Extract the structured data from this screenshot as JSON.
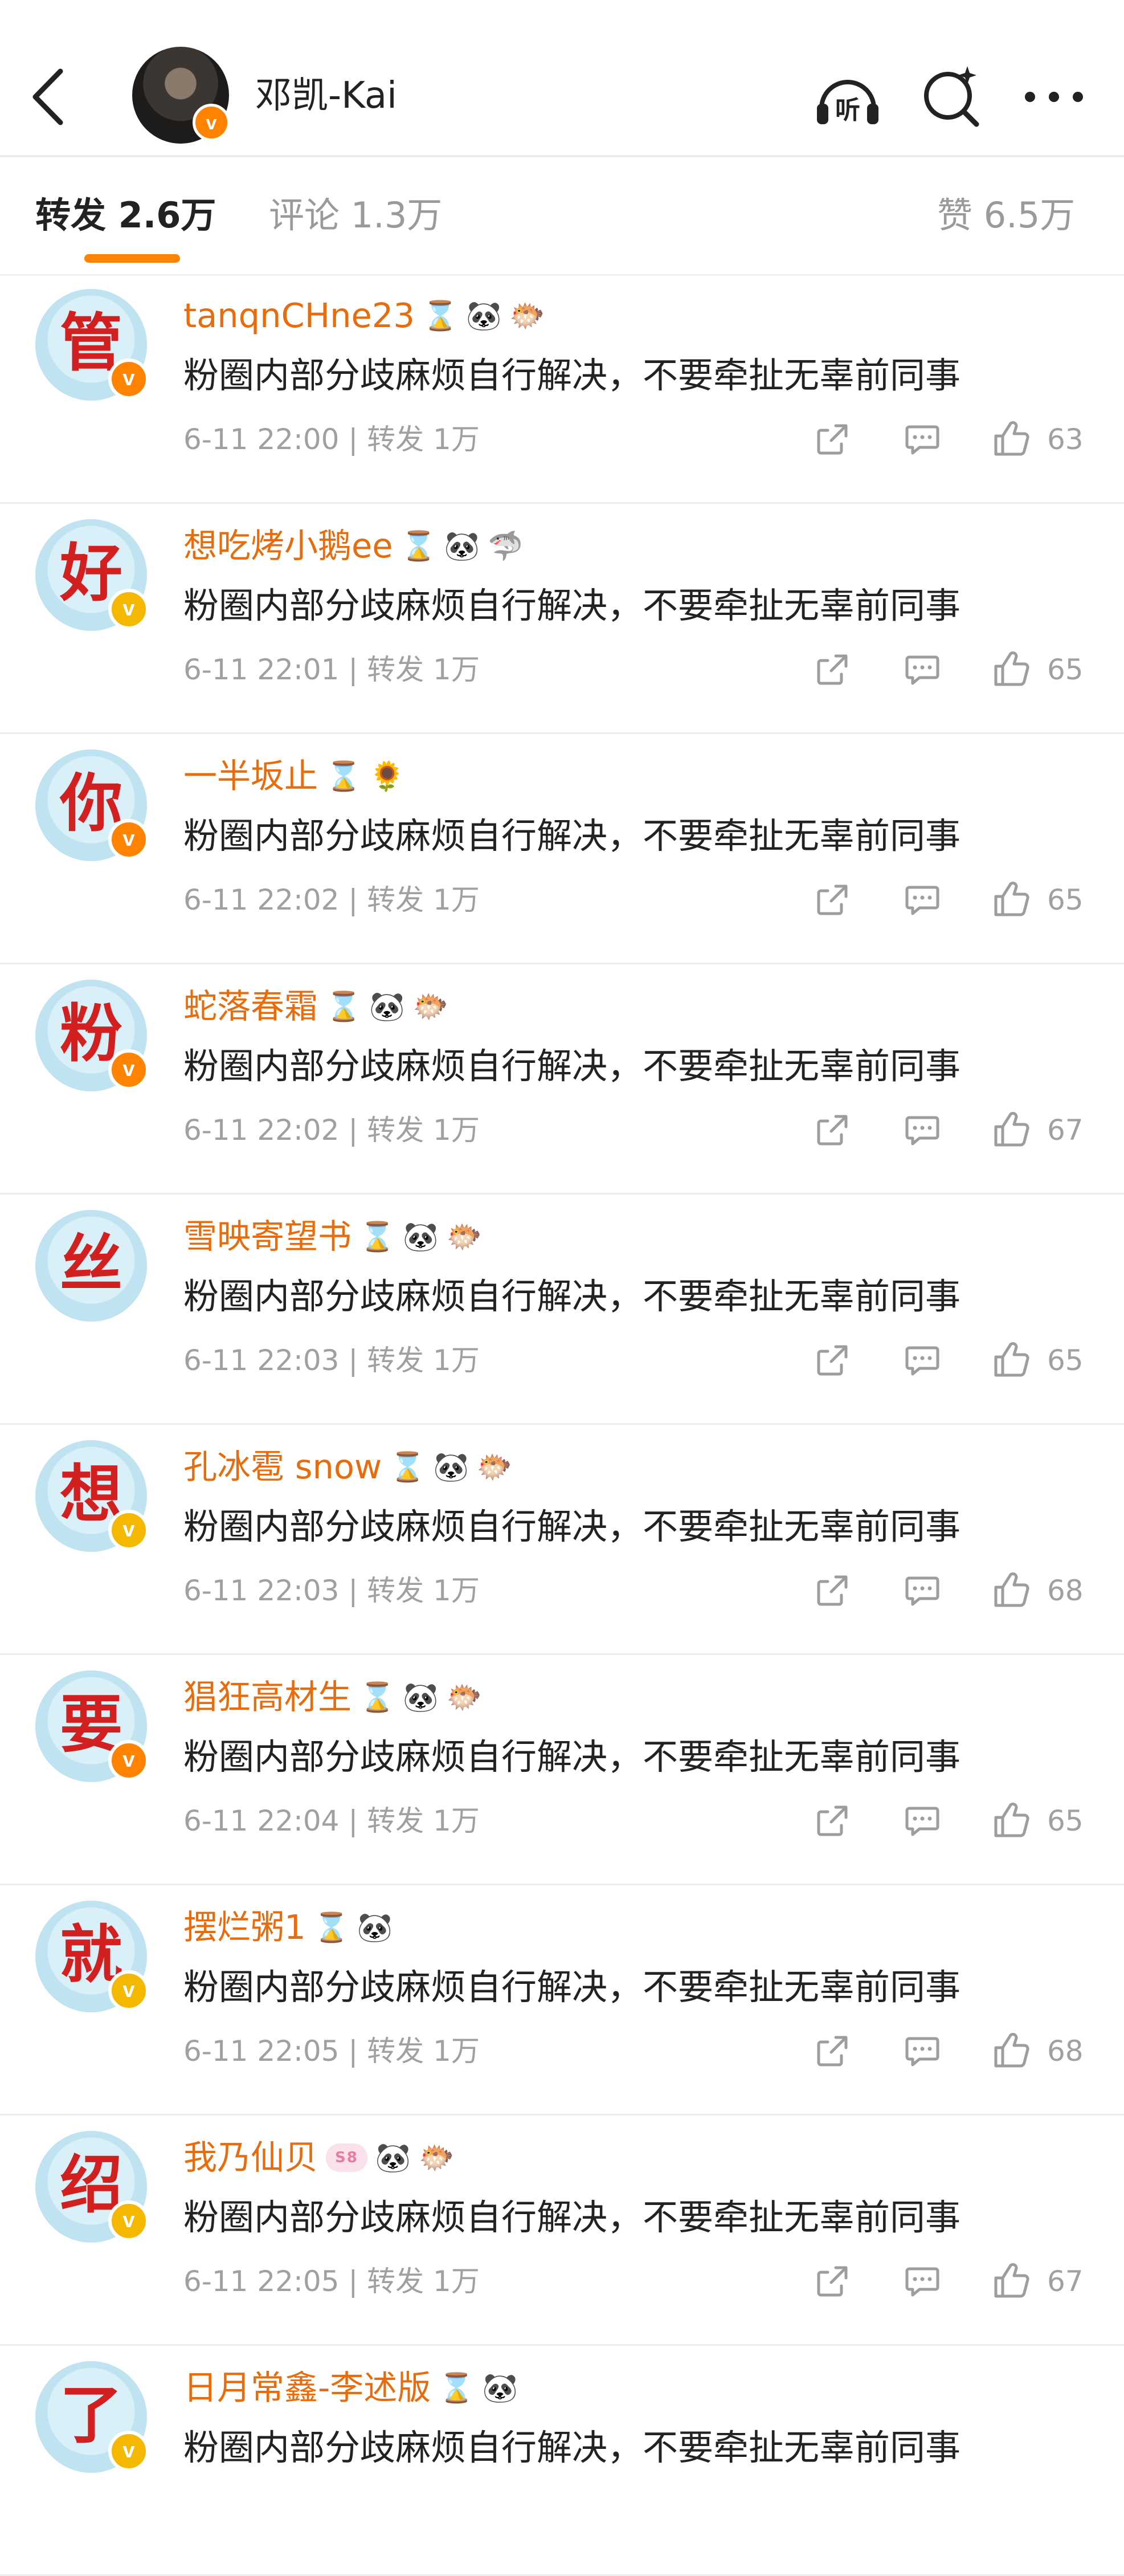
{
  "header": {
    "title": "邓凯-Kai",
    "verified_color": "#ff8200",
    "icons": [
      "back-arrow-icon",
      "listen-icon",
      "search-icon",
      "more-icon"
    ],
    "listen_label": "听"
  },
  "tabs": [
    {
      "label": "转发 2.6万",
      "active": true
    },
    {
      "label": "评论 1.3万",
      "active": false
    },
    {
      "label": "赞 6.5万",
      "active": false
    }
  ],
  "repost_label": "转发",
  "repost_count": "1万",
  "reposts": [
    {
      "avatar_char": "管",
      "badge": "orange",
      "username": "tanqnCHne23",
      "emojis": [
        "⌛",
        "🐼",
        "🐡"
      ],
      "content": "粉圈内部分歧麻烦自行解决，不要牵扯无辜前同事",
      "time": "6-11 22:00",
      "likes": "63"
    },
    {
      "avatar_char": "好",
      "badge": "yellow",
      "username": "想吃烤小鹅ee",
      "emojis": [
        "⌛",
        "🐼",
        "🦈"
      ],
      "content": "粉圈内部分歧麻烦自行解决，不要牵扯无辜前同事",
      "time": "6-11 22:01",
      "likes": "65"
    },
    {
      "avatar_char": "你",
      "badge": "orange",
      "username": "一半坂止",
      "emojis": [
        "⌛",
        "🌻"
      ],
      "content": "粉圈内部分歧麻烦自行解决，不要牵扯无辜前同事",
      "time": "6-11 22:02",
      "likes": "65"
    },
    {
      "avatar_char": "粉",
      "badge": "orange",
      "username": "蛇落春霜",
      "emojis": [
        "⌛",
        "🐼",
        "🐡"
      ],
      "content": "粉圈内部分歧麻烦自行解决，不要牵扯无辜前同事",
      "time": "6-11 22:02",
      "likes": "67"
    },
    {
      "avatar_char": "丝",
      "badge": "none",
      "username": "雪映寄望书",
      "emojis": [
        "⌛",
        "🐼",
        "🐡"
      ],
      "content": "粉圈内部分歧麻烦自行解决，不要牵扯无辜前同事",
      "time": "6-11 22:03",
      "likes": "65"
    },
    {
      "avatar_char": "想",
      "badge": "yellow",
      "username": "孔冰雹 snow",
      "emojis": [
        "⌛",
        "🐼",
        "🐡"
      ],
      "content": "粉圈内部分歧麻烦自行解决，不要牵扯无辜前同事",
      "time": "6-11 22:03",
      "likes": "68"
    },
    {
      "avatar_char": "要",
      "badge": "orange",
      "username": "猖狂高材生",
      "emojis": [
        "⌛",
        "🐼",
        "🐡"
      ],
      "content": "粉圈内部分歧麻烦自行解决，不要牵扯无辜前同事",
      "time": "6-11 22:04",
      "likes": "65"
    },
    {
      "avatar_char": "就",
      "badge": "yellow",
      "username": "摆烂粥1",
      "emojis": [
        "⌛",
        "🐼"
      ],
      "content": "粉圈内部分歧麻烦自行解决，不要牵扯无辜前同事",
      "time": "6-11 22:05",
      "likes": "68"
    },
    {
      "avatar_char": "绍",
      "badge": "yellow",
      "username": "我乃仙贝",
      "emojis": [
        "S8",
        "🐼",
        "🐡"
      ],
      "content": "粉圈内部分歧麻烦自行解决，不要牵扯无辜前同事",
      "time": "6-11 22:05",
      "likes": "67"
    },
    {
      "avatar_char": "了",
      "badge": "yellow",
      "username": "日月常鑫-李述版",
      "emojis": [
        "⌛",
        "🐼"
      ],
      "content": "粉圈内部分歧麻烦自行解决，不要牵扯无辜前同事",
      "time": "",
      "likes": ""
    }
  ],
  "colors": {
    "username": "#e86b0c",
    "badge_orange": "#ff8200",
    "badge_yellow": "#f5b800",
    "accent": "#ff8200"
  }
}
